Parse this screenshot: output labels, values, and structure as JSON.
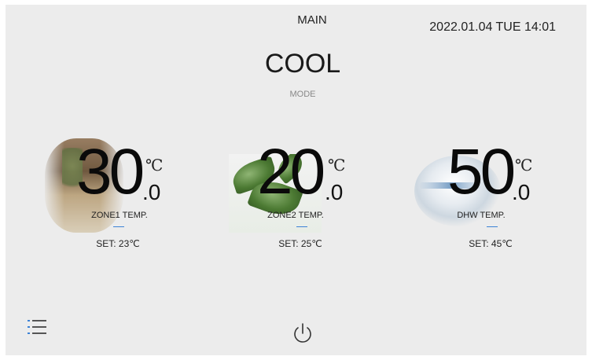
{
  "header": {
    "title": "MAIN",
    "datetime": "2022.01.04 TUE 14:01"
  },
  "mode": {
    "value": "COOL",
    "label": "MODE"
  },
  "zones": [
    {
      "temp_int": "30",
      "temp_dec": ".0",
      "unit": "℃",
      "label": "ZONE1 TEMP.",
      "set": "SET: 23℃",
      "image": "indoor-room-photo"
    },
    {
      "temp_int": "20",
      "temp_dec": ".0",
      "unit": "℃",
      "label": "ZONE2 TEMP.",
      "set": "SET: 25℃",
      "image": "green-leaf-photo"
    },
    {
      "temp_int": "50",
      "temp_dec": ".0",
      "unit": "℃",
      "label": "DHW TEMP.",
      "set": "SET: 45℃",
      "image": "water-tap-photo"
    }
  ],
  "icons": {
    "menu": "menu-list-icon",
    "power": "power-icon"
  },
  "colors": {
    "background": "#ececec",
    "accent": "#3c82d6",
    "text": "#222222"
  }
}
